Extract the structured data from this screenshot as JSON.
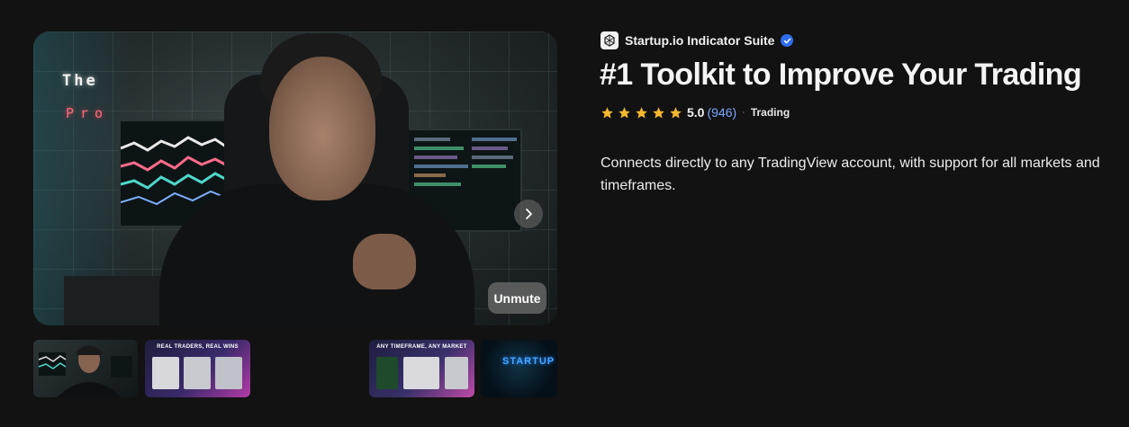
{
  "media": {
    "video_overlay_line1": "The",
    "video_overlay_line2": "Pro",
    "unmute_label": "Unmute",
    "next_icon": "chevron-right-icon"
  },
  "thumbnails": [
    {
      "caption": ""
    },
    {
      "caption": "REAL TRADERS, REAL WINS"
    },
    {
      "caption": "ANY TIMEFRAME, ANY MARKET"
    },
    {
      "caption": "STARTUP"
    }
  ],
  "product": {
    "seller_name": "Startup.io Indicator Suite",
    "verified_icon": "verified-check-icon",
    "title": "#1 Toolkit to Improve Your Trading",
    "rating": "5.0",
    "rating_count": "(946)",
    "separator": "·",
    "category": "Trading",
    "stars": 5,
    "description": "Connects directly to any TradingView account, with support for all markets and timeframes."
  },
  "colors": {
    "background": "#121212",
    "star": "#f5b82e",
    "link": "#7aa7ff",
    "verified": "#2f6df0"
  }
}
